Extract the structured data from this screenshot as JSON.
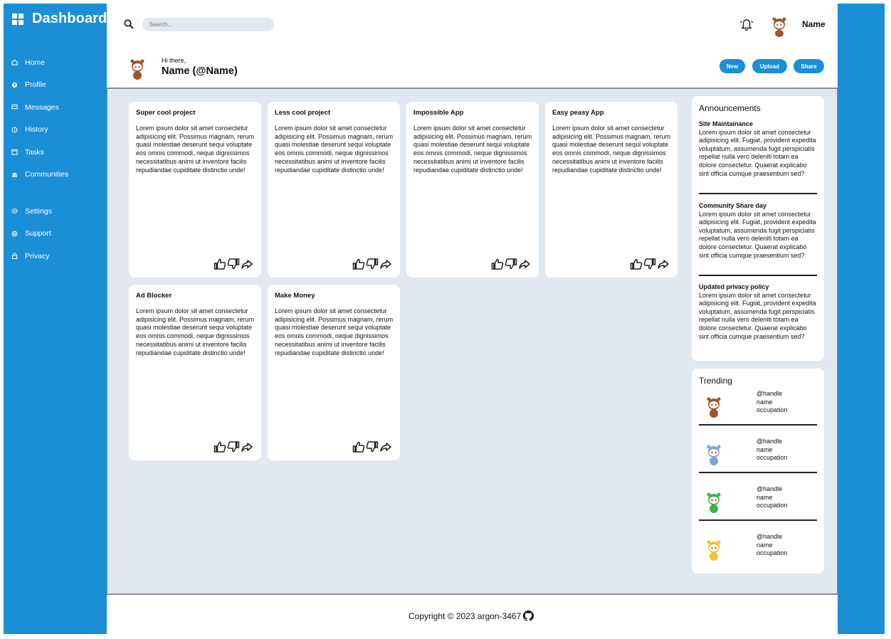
{
  "app": {
    "title": "Dashboard"
  },
  "sidebar": {
    "items": [
      {
        "label": "Home",
        "icon": "home-icon"
      },
      {
        "label": "Profile",
        "icon": "profile-icon"
      },
      {
        "label": "Messages",
        "icon": "messages-icon"
      },
      {
        "label": "History",
        "icon": "history-icon"
      },
      {
        "label": "Tasks",
        "icon": "tasks-icon"
      },
      {
        "label": "Communities",
        "icon": "communities-icon"
      }
    ],
    "bottom_items": [
      {
        "label": "Settings",
        "icon": "settings-icon"
      },
      {
        "label": "Support",
        "icon": "support-icon"
      },
      {
        "label": "Privacy",
        "icon": "privacy-icon"
      }
    ]
  },
  "header": {
    "search_placeholder": "Search...",
    "user_name": "Name"
  },
  "greeting": {
    "hi": "Hi there,",
    "name": "Name (@Name)",
    "buttons": [
      "New",
      "Upload",
      "Share"
    ]
  },
  "projects": [
    {
      "title": "Super cool project",
      "text": "Lorem ipsum dolor sit amet consectetur adipisicing elit. Possimus magnam, rerum quasi molestiae deserunt sequi voluptate eos omnis commodi, neque dignissimos necessitatibus animi ut inventore facilis repudiandae cupiditate distinctio unde!"
    },
    {
      "title": "Less cool project",
      "text": "Lorem ipsum dolor sit amet consectetur adipisicing elit. Possimus magnam, rerum quasi molestiae deserunt sequi voluptate eos omnis commodi, neque dignissimos necessitatibus animi ut inventore facilis repudiandae cupiditate distinctio unde!"
    },
    {
      "title": "Impossible App",
      "text": "Lorem ipsum dolor sit amet consectetur adipisicing elit. Possimus magnam, rerum quasi molestiae deserunt sequi voluptate eos omnis commodi, neque dignissimos necessitatibus animi ut inventore facilis repudiandae cupiditate distinctio unde!"
    },
    {
      "title": "Easy peasy App",
      "text": "Lorem ipsum dolor sit amet consectetur adipisicing elit. Possimus magnam, rerum quasi molestiae deserunt sequi voluptate eos omnis commodi, neque dignissimos necessitatibus animi ut inventore facilis repudiandae cupiditate distinctio unde!"
    },
    {
      "title": "Ad Blocker",
      "text": "Lorem ipsum dolor sit amet consectetur adipisicing elit. Possimus magnam, rerum quasi molestiae deserunt sequi voluptate eos omnis commodi, neque dignissimos necessitatibus animi ut inventore facilis repudiandae cupiditate distinctio unde!"
    },
    {
      "title": "Make Money",
      "text": "Lorem ipsum dolor sit amet consectetur adipisicing elit. Possimus magnam, rerum quasi molestiae deserunt sequi voluptate eos omnis commodi, neque dignissimos necessitatibus animi ut inventore facilis repudiandae cupiditate distinctio unde!"
    }
  ],
  "announcements": {
    "title": "Announcements",
    "items": [
      {
        "heading": "Site Maintainance",
        "text": "Lorem ipsum dolor sit amet consectetur adipisicing elit. Fugiat, provident expedita voluptatum, assumenda fugit perspiciatis repellat nulla vero deleniti totam ea dolore consectetur. Quaerat explicabo sint officia cumque praesentium sed?"
      },
      {
        "heading": "Community Share day",
        "text": "Lorem ipsum dolor sit amet consectetur adipisicing elit. Fugiat, provident expedita voluptatum, assumenda fugit perspiciatis repellat nulla vero deleniti totam ea dolore consectetur. Quaerat explicabo sint officia cumque praesentium sed?"
      },
      {
        "heading": "Updated privacy policy",
        "text": "Lorem ipsum dolor sit amet consectetur adipisicing elit. Fugiat, provident expedita voluptatum, assumenda fugit perspiciatis repellat nulla vero deleniti totam ea dolore consectetur. Quaerat explicabo sint officia cumque praesentium sed?"
      }
    ]
  },
  "trending": {
    "title": "Trending",
    "items": [
      {
        "handle": "@handle",
        "name": "name",
        "occupation": "occupation",
        "avatar_color": "#a0522d"
      },
      {
        "handle": "@handle",
        "name": "name",
        "occupation": "occupation",
        "avatar_color": "#7fa6c9"
      },
      {
        "handle": "@handle",
        "name": "name",
        "occupation": "occupation",
        "avatar_color": "#3cb34a"
      },
      {
        "handle": "@handle",
        "name": "name",
        "occupation": "occupation",
        "avatar_color": "#f2c230"
      }
    ]
  },
  "footer": {
    "text": "Copyright © 2023 argon-3467"
  },
  "colors": {
    "accent": "#1a8fd6",
    "content_bg": "#e2e8f0"
  }
}
